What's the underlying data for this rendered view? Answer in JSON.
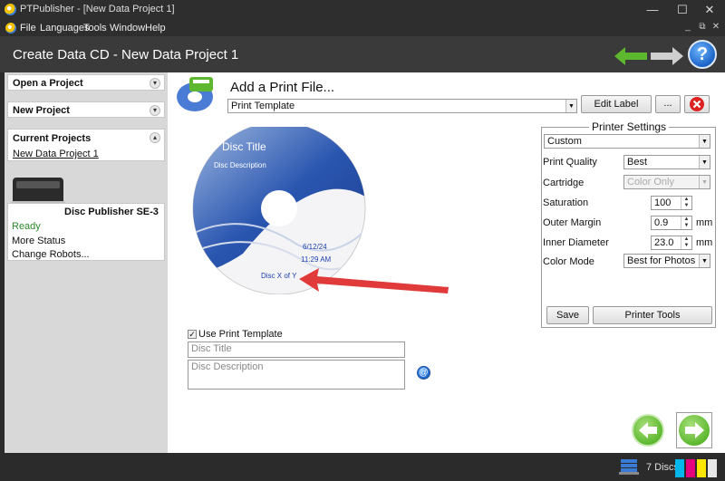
{
  "window": {
    "title": "PTPublisher - [New Data Project 1]",
    "minimize": "—",
    "maximize": "☐",
    "close": "✕"
  },
  "menu": {
    "items": [
      "File",
      "Languages",
      "Tools",
      "Window",
      "Help"
    ],
    "mdi_min": "_",
    "mdi_restore": "⧉",
    "mdi_close": "✕"
  },
  "header": {
    "title": "Create Data CD  -  New Data Project 1",
    "help": "?"
  },
  "sidebar": {
    "open_project": "Open a Project",
    "new_project": "New Project",
    "current_projects": "Current Projects",
    "current_item": "New Data Project 1",
    "publisher_name": "Disc Publisher SE-3",
    "status_ready": "Ready",
    "more_status": "More Status",
    "change_robots": "Change Robots..."
  },
  "print": {
    "heading": "Add a Print File...",
    "template_value": "Print Template",
    "edit_label": "Edit Label",
    "browse": "...",
    "disc_title": "Disc Title",
    "disc_description": "Disc Description",
    "date": "6/12/24",
    "time": "11:29 AM",
    "disc_number": "Disc X of Y",
    "use_template": "Use Print Template",
    "title_placeholder": "Disc Title",
    "desc_placeholder": "Disc Description"
  },
  "printer": {
    "heading": "Printer Settings",
    "profile": "Custom",
    "print_quality_label": "Print Quality",
    "print_quality": "Best",
    "cartridge_label": "Cartridge",
    "cartridge": "Color Only",
    "saturation_label": "Saturation",
    "saturation": "100",
    "outer_margin_label": "Outer Margin",
    "outer_margin": "0.9",
    "inner_diameter_label": "Inner Diameter",
    "inner_diameter": "23.0",
    "unit": "mm",
    "color_mode_label": "Color Mode",
    "color_mode": "Best for Photos",
    "save": "Save",
    "printer_tools": "Printer Tools"
  },
  "status": {
    "discs": "7 Discs"
  },
  "colors": {
    "accent_green": "#5db830",
    "ready_green": "#2a8a2a",
    "link_blue": "#1a3fb0",
    "close_red": "#d22"
  }
}
